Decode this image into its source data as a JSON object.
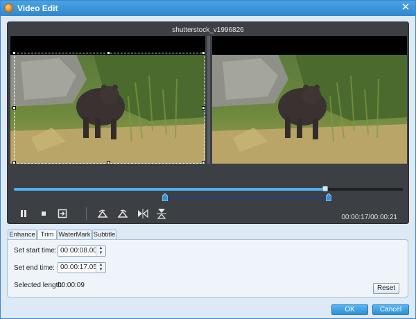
{
  "window": {
    "title": "Video Edit",
    "close_glyph": "✕",
    "icon": "app-orange-circle-icon"
  },
  "preview": {
    "filename": "shutterstock_v1996826",
    "position": 0.801,
    "trim_start_fraction": 0.388,
    "trim_end_fraction": 0.81,
    "time_display": "00:00:17/00:00:21"
  },
  "controls": [
    {
      "name": "pause-icon"
    },
    {
      "name": "stop-icon"
    },
    {
      "name": "snapshot-icon"
    },
    {
      "name": "rotate-left-icon"
    },
    {
      "name": "rotate-right-icon"
    },
    {
      "name": "flip-horizontal-icon"
    },
    {
      "name": "flip-vertical-icon"
    }
  ],
  "tabs": [
    {
      "label": "Enhance"
    },
    {
      "label": "Trim",
      "active": true
    },
    {
      "label": "WaterMark"
    },
    {
      "label": "Subtitle"
    }
  ],
  "trim": {
    "start_label": "Set start time:",
    "start_value": "00:00:08.00",
    "end_label": "Set end time:",
    "end_value": "00:00:17.05",
    "length_label": "Selected length:",
    "length_value": "00:00:09",
    "reset_label": "Reset"
  },
  "footer": {
    "ok_label": "OK",
    "cancel_label": "Cancel"
  },
  "colors": {
    "titlebar": "#2f87cf",
    "accent": "#4fb0f2",
    "panel": "#3c3f43"
  }
}
